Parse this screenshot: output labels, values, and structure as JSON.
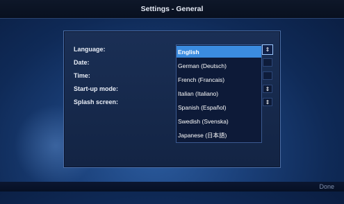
{
  "window": {
    "title": "Settings - General"
  },
  "settings": {
    "labels": [
      "Language:",
      "Date:",
      "Time:",
      "Start-up mode:",
      "Splash screen:"
    ]
  },
  "language_dropdown": {
    "selected": "English",
    "options": [
      "English",
      "German (Deutsch)",
      "French (Francais)",
      "Italian (Italiano)",
      "Spanish (Español)",
      "Swedish (Svenska)",
      "Japanese (日本語)"
    ],
    "spinner_icon": "up-down-arrows-icon"
  },
  "footer": {
    "done_label": "Done"
  },
  "colors": {
    "selection": "#3b8ce0",
    "background": "#1a3f78",
    "panel": "#1a2f55"
  }
}
